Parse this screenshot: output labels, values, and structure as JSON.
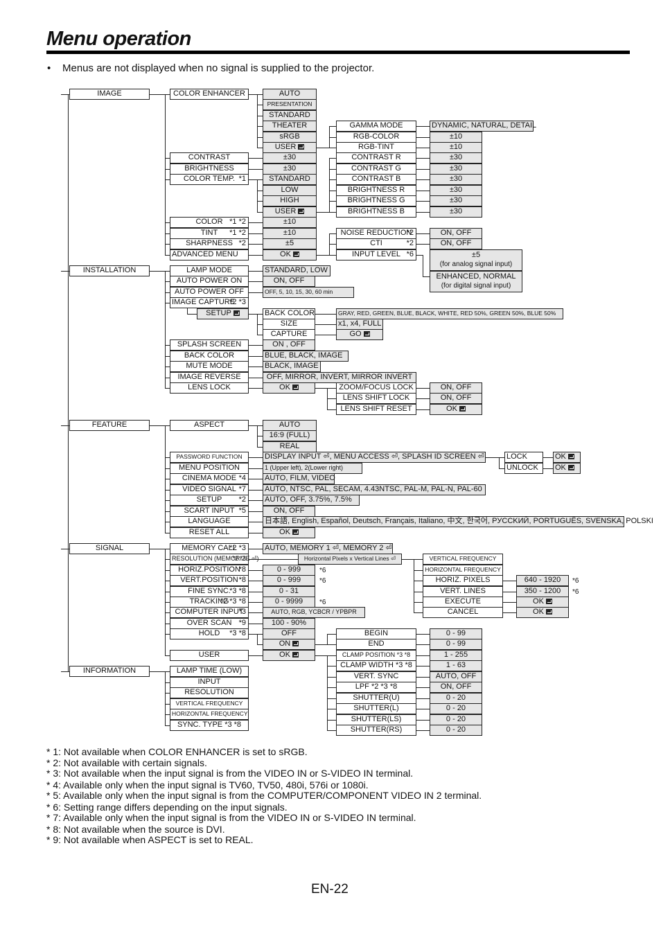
{
  "header": {
    "title": "Menu operation",
    "bullet": "Menus are not displayed when no signal is supplied to the projector."
  },
  "top_menus": [
    "IMAGE",
    "INSTALLATION",
    "FEATURE",
    "SIGNAL",
    "INFORMATION"
  ],
  "image": {
    "items": [
      "COLOR ENHANCER",
      "CONTRAST",
      "BRIGHTNESS",
      "COLOR TEMP.",
      "COLOR",
      "TINT",
      "SHARPNESS",
      "ADVANCED MENU"
    ],
    "notes": {
      "color_temp": "*1",
      "color": "*1 *2",
      "tint": "*1 *2",
      "sharpness": "*2"
    },
    "color_enhancer_options": [
      "AUTO",
      "PRESENTATION",
      "STANDARD",
      "THEATER",
      "sRGB",
      "USER"
    ],
    "contrast_value": "±30",
    "brightness_value": "±30",
    "color_temp_options": [
      "STANDARD",
      "LOW",
      "HIGH",
      "USER"
    ],
    "color_value": "±10",
    "tint_value": "±10",
    "sharpness_value": "±5",
    "advanced_value": "OK",
    "user_sub": [
      "GAMMA MODE",
      "RGB-COLOR",
      "RGB-TINT",
      "CONTRAST R",
      "CONTRAST G",
      "CONTRAST B",
      "BRIGHTNESS R",
      "BRIGHTNESS G",
      "BRIGHTNESS B"
    ],
    "user_sub_values": [
      "DYNAMIC, NATURAL, DETAIL",
      "±10",
      "±10",
      "±30",
      "±30",
      "±30",
      "±30",
      "±30",
      "±30"
    ],
    "advanced_sub": [
      "NOISE REDUCTION",
      "CTI",
      "INPUT LEVEL"
    ],
    "advanced_notes": [
      "*2",
      "*2",
      "*6"
    ],
    "advanced_values": [
      "ON, OFF",
      "ON, OFF"
    ],
    "input_level_analog": [
      "±5",
      "(for analog signal input)"
    ],
    "input_level_digital": [
      "ENHANCED, NORMAL",
      "(for digital signal input)"
    ]
  },
  "installation": {
    "items": [
      "LAMP MODE",
      "AUTO POWER ON",
      "AUTO POWER OFF",
      "IMAGE CAPTURE",
      "SPLASH SCREEN",
      "BACK COLOR",
      "MUTE MODE",
      "IMAGE REVERSE",
      "LENS LOCK"
    ],
    "image_capture_note": "*2 *3",
    "values": [
      "STANDARD, LOW",
      "ON, OFF",
      "OFF,  5,  10,  15,  30,  60 min",
      "ON , OFF",
      "BLUE, BLACK, IMAGE",
      "BLACK, IMAGE",
      "OFF, MIRROR, INVERT, MIRROR INVERT",
      "OK"
    ],
    "setup_label": "SETUP",
    "setup_sub": [
      "BACK COLOR",
      "SIZE",
      "CAPTURE"
    ],
    "setup_values": [
      "GRAY, RED, GREEN, BLUE, BLACK, WHITE, RED 50%, GREEN 50%, BLUE 50%",
      "x1, x4, FULL",
      "GO"
    ],
    "lens_sub": [
      "ZOOM/FOCUS LOCK",
      "LENS SHIFT LOCK",
      "LENS SHIFT RESET"
    ],
    "lens_values": [
      "ON, OFF",
      "ON, OFF",
      "OK"
    ]
  },
  "feature": {
    "items": [
      "ASPECT",
      "PASSWORD FUNCTION",
      "MENU POSITION",
      "CINEMA MODE",
      "VIDEO SIGNAL",
      "SETUP",
      "SCART INPUT",
      "LANGUAGE",
      "RESET ALL"
    ],
    "notes": {
      "cinema": "*4",
      "video": "*7",
      "setup": "*2",
      "scart": "*5"
    },
    "aspect_options": [
      "AUTO",
      "16:9 (FULL)",
      "REAL"
    ],
    "password_value": "DISPLAY INPUT ⏎, MENU ACCESS ⏎, SPLASH ID SCREEN ⏎",
    "password_sub": [
      "LOCK",
      "UNLOCK"
    ],
    "password_sub_values": [
      "OK",
      "OK"
    ],
    "values": [
      "1 (Upper left), 2(Lower right)",
      "AUTO, FILM, VIDEO",
      "AUTO, NTSC, PAL, SECAM, 4.43NTSC, PAL-M, PAL-N, PAL-60",
      "AUTO, OFF, 3.75%, 7.5%",
      "ON, OFF",
      "日本語, English, Español, Deutsch, Français, Italiano, 中文, 한국어, PУCCKИЙ, PORTUGUÊS, SVENSKA, POLSKI",
      "OK"
    ]
  },
  "signal": {
    "items": [
      "MEMORY CALL",
      "RESOLUTION (MEMORIZE ⏎)",
      "HORIZ.POSITION",
      "VERT.POSITION",
      "FINE SYNC.",
      "TRACKING",
      "COMPUTER INPUT",
      "OVER SCAN",
      "HOLD",
      "USER"
    ],
    "notes": [
      "*2 *3",
      "*2 *3",
      "*8",
      "*8",
      "*3 *8",
      "*2 *3 *8",
      "*3",
      "*9",
      "*3 *8",
      ""
    ],
    "values": [
      "AUTO, MEMORY 1 ⏎, MEMORY 2 ⏎",
      "Horizontal Pixels x Vertical Lines ⏎",
      "0 - 999",
      "0 - 999",
      "0 - 31",
      "0 - 9999",
      "AUTO, RGB, YCBCR / YPBPR",
      "100 - 90%",
      "OFF",
      "ON",
      "OK"
    ],
    "value_notes": [
      "*6",
      "*6",
      "*6"
    ],
    "resolution_sub": [
      "VERTICAL FREQUENCY",
      "HORIZONTAL FREQUENCY",
      "HORIZ. PIXELS",
      "VERT. LINES",
      "EXECUTE",
      "CANCEL"
    ],
    "resolution_sub_values": [
      "640 - 1920",
      "350 - 1200",
      "OK",
      "OK"
    ],
    "resolution_sub_notes": [
      "*6",
      "*6"
    ],
    "user_sub": [
      "BEGIN",
      "END",
      "CLAMP POSITION *3 *8",
      "CLAMP WIDTH   *3 *8",
      "VERT. SYNC",
      "LPF   *2 *3 *8",
      "SHUTTER(U)",
      "SHUTTER(L)",
      "SHUTTER(LS)",
      "SHUTTER(RS)"
    ],
    "user_sub_values": [
      "0 - 99",
      "0 - 99",
      "1 - 255",
      "1 - 63",
      "AUTO, OFF",
      "ON, OFF",
      "0 - 20",
      "0 - 20",
      "0 - 20",
      "0 - 20"
    ]
  },
  "information": {
    "items": [
      "LAMP TIME (LOW)",
      "INPUT",
      "RESOLUTION",
      "VERTICAL FREQUENCY",
      "HORIZONTAL FREQUENCY",
      "SYNC. TYPE *3 *8"
    ]
  },
  "footnotes": [
    "* 1: Not available when COLOR ENHANCER is set to sRGB.",
    "* 2: Not available with certain signals.",
    "* 3: Not available when the input signal is from the VIDEO IN or S-VIDEO IN terminal.",
    "* 4: Available only when the input signal is TV60, TV50, 480i, 576i or 1080i.",
    "* 5: Available only when the input signal is from the COMPUTER/COMPONENT VIDEO IN 2 terminal.",
    "* 6: Setting range differs depending on the input signals.",
    "* 7: Available only when the input signal is from the VIDEO IN or S-VIDEO IN terminal.",
    "* 8: Not available when the source is DVI.",
    "* 9: Not available when ASPECT is set to REAL."
  ],
  "page_number": "EN-22"
}
